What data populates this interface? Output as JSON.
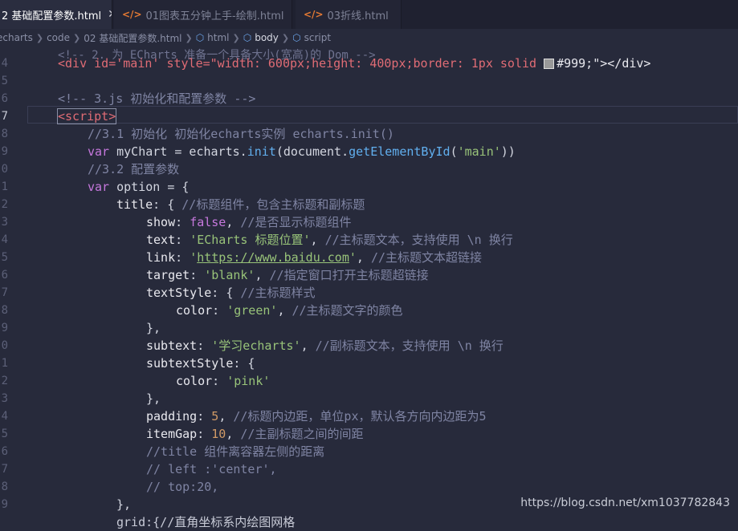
{
  "tabs": [
    {
      "label": "2 基础配置参数.html",
      "active": true,
      "close": "✕"
    },
    {
      "label": "01图表五分钟上手-绘制.html",
      "active": false
    },
    {
      "label": "03折线.html",
      "active": false
    }
  ],
  "breadcrumb": [
    "echarts",
    "code",
    "02 基础配置参数.html",
    "html",
    "body",
    "script"
  ],
  "line_numbers": [
    "4",
    "5",
    "6",
    "7",
    "8",
    "9",
    "0",
    "1",
    "2",
    "3",
    "4",
    "5",
    "6",
    "7",
    "8",
    "9",
    "0",
    "1",
    "2",
    "3",
    "4",
    "5",
    "6",
    "7",
    "8",
    "9"
  ],
  "code": {
    "l0_hidden": "<!-- 2. 为 ECharts 准备一个具备大小(宽高)的 Dom -->",
    "l1_div": "<div id='main' style=\"width: 600px;height: 400px;border: 1px solid ",
    "l1_color": "#999;\"></div>",
    "l3_comment": "<!-- 3.js 初始化和配置参数 -->",
    "l4_script": "<script>",
    "l5": "//3.1 初始化 初始化echarts实例 echarts.init()",
    "l6_var": "var",
    "l6_a": " myChart = echarts.",
    "l6_init": "init",
    "l6_b": "(document.",
    "l6_get": "getElementById",
    "l6_c": "(",
    "l6_str": "'main'",
    "l6_d": "))",
    "l7": "//3.2 配置参数",
    "l8_var": "var",
    "l8_rest": " option = {",
    "l9_key": "title",
    "l9_rest": ": { ",
    "l9_cmt": "//标题组件，包含主标题和副标题",
    "l10_key": "show",
    "l10_val": "false",
    "l10_cmt": "//是否显示标题组件",
    "l11_key": "text",
    "l11_val": "'ECharts 标题位置'",
    "l11_cmt": "//主标题文本，支持使用 \\n 换行",
    "l12_key": "link",
    "l12_q1": "'",
    "l12_url": "https://www.baidu.com",
    "l12_q2": "'",
    "l12_cmt": "//主标题文本超链接",
    "l13_key": "target",
    "l13_val": "'blank'",
    "l13_cmt": "//指定窗口打开主标题超链接",
    "l14_key": "textStyle",
    "l14_cmt": "//主标题样式",
    "l15_key": "color",
    "l15_val": "'green'",
    "l15_cmt": "//主标题文字的颜色",
    "l16": "},",
    "l17_key": "subtext",
    "l17_val": "'学习echarts'",
    "l17_cmt": "//副标题文本，支持使用 \\n 换行",
    "l18_key": "subtextStyle",
    "l19_key": "color",
    "l19_val": "'pink'",
    "l20": "},",
    "l21_key": "padding",
    "l21_val": "5",
    "l21_cmt": "//标题内边距，单位px，默认各方向内边距为5",
    "l22_key": "itemGap",
    "l22_val": "10",
    "l22_cmt": "//主副标题之间的间距",
    "l23": "//title 组件离容器左侧的距离",
    "l24": "// left :'center',",
    "l25": "// top:20,",
    "l26": "},",
    "l27": "grid:{//直角坐标系内绘图网格"
  },
  "watermark": "https://blog.csdn.net/xm1037782843"
}
